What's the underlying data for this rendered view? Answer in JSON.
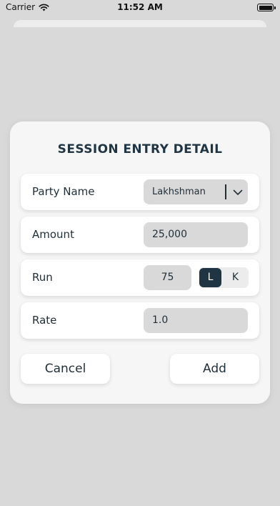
{
  "status_bar": {
    "carrier": "Carrier",
    "time": "11:52 AM",
    "icons": [
      "wifi-icon",
      "battery-icon"
    ]
  },
  "dialog": {
    "title": "SESSION ENTRY DETAIL",
    "party_name": {
      "label": "Party Name",
      "value": "Lakhshman"
    },
    "amount": {
      "label": "Amount",
      "value": "25,000"
    },
    "run": {
      "label": "Run",
      "value": "75",
      "options": [
        "L",
        "K"
      ],
      "selected": "L"
    },
    "rate": {
      "label": "Rate",
      "value": "1.0"
    },
    "cancel_label": "Cancel",
    "add_label": "Add"
  },
  "colors": {
    "background": "#d9d9d9",
    "card": "#f6f6f6",
    "accent": "#1f3544",
    "field": "#d9d9d9"
  }
}
